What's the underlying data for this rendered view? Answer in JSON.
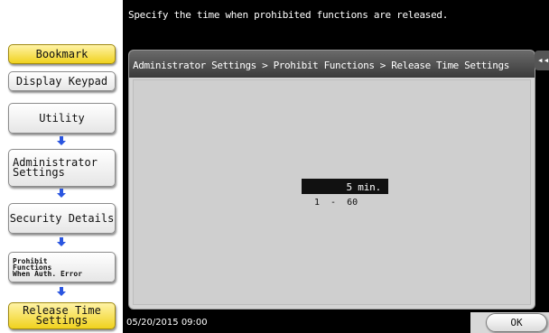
{
  "header": {
    "message": "Specify the time when prohibited functions are released."
  },
  "left_nav": {
    "bookmark": "Bookmark",
    "display_keypad": "Display Keypad",
    "utility": "Utility",
    "administrator_settings_line1": "Administrator",
    "administrator_settings_line2": "Settings",
    "security_details": "Security Details",
    "prohibit_line1": "Prohibit",
    "prohibit_line2": "Functions",
    "prohibit_line3": "When Auth. Error",
    "release_time_line1": "Release Time",
    "release_time_line2": "Settings"
  },
  "breadcrumb": "Administrator Settings > Prohibit Functions > Release Time Settings",
  "setting": {
    "value": "5 min.",
    "range": "1  -  60"
  },
  "side_tab_glyph": "◂◂",
  "footer": {
    "datetime": "05/20/2015  09:00",
    "ok_label": "OK"
  },
  "colors": {
    "highlight_button": "#f0d21e",
    "arrow": "#2a55e0",
    "bar": "#000000",
    "panel": "#d4d4d4"
  }
}
